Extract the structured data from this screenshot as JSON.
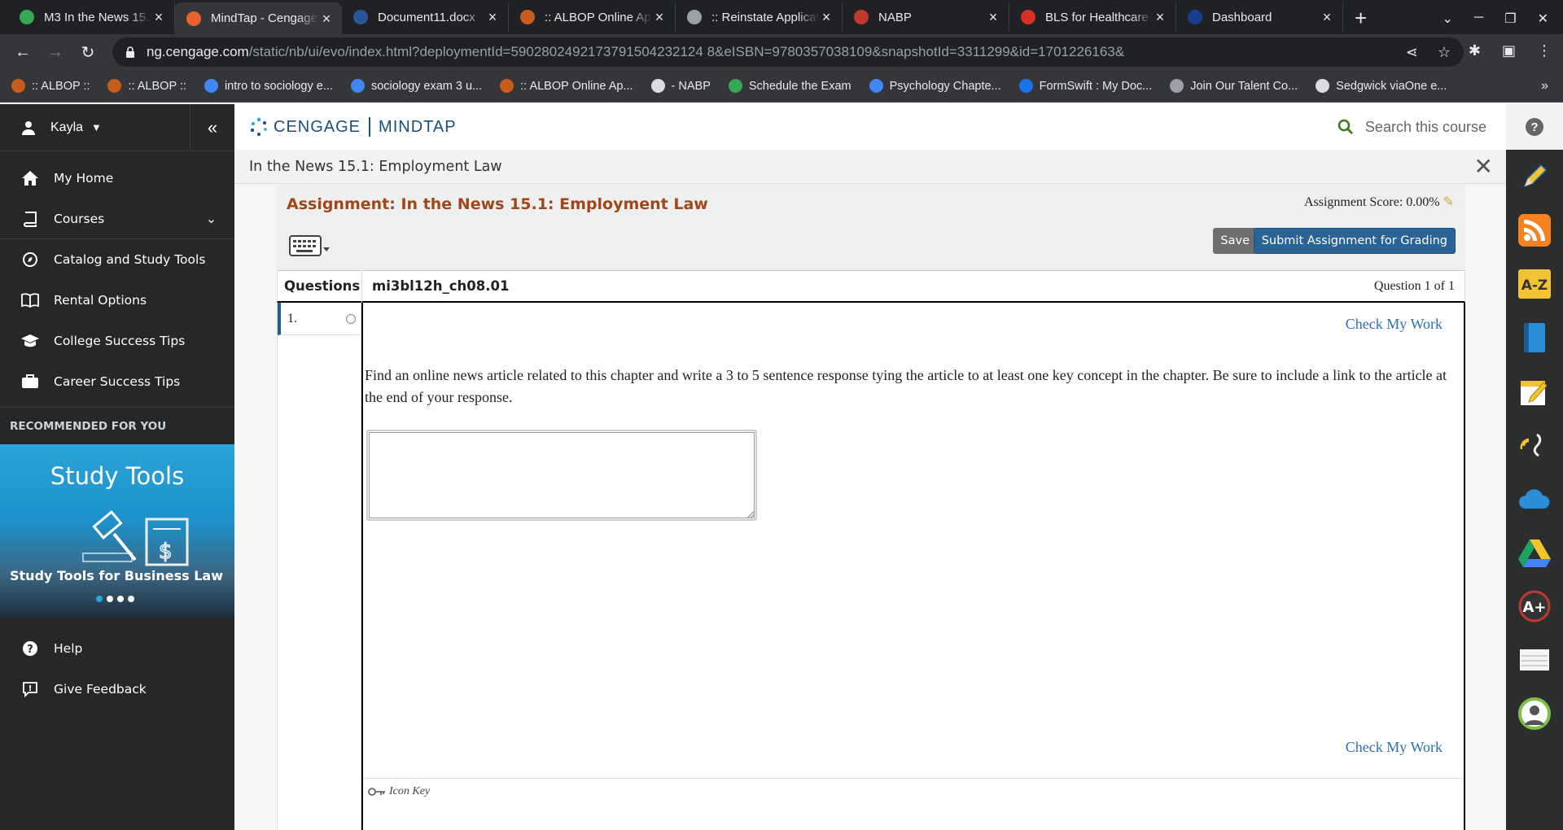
{
  "browser": {
    "tabs": [
      {
        "title": "M3 In the News 15.1",
        "icon_color": "#34a853",
        "active": false
      },
      {
        "title": "MindTap - Cengage Learning",
        "icon_color": "#e8632b",
        "active": true
      },
      {
        "title": "Document11.docx",
        "icon_color": "#2b579a",
        "active": false
      },
      {
        "title": ":: ALBOP Online Applications",
        "icon_color": "#c65d1c",
        "active": false
      },
      {
        "title": ":: Reinstate Application",
        "icon_color": "#9aa0a6",
        "active": false
      },
      {
        "title": "NABP",
        "icon_color": "#c0392b",
        "active": false
      },
      {
        "title": "BLS for Healthcare Providers",
        "icon_color": "#d93025",
        "active": false
      },
      {
        "title": "Dashboard",
        "icon_color": "#1a3d8f",
        "active": false
      }
    ],
    "url_host": "ng.cengage.com",
    "url_path": "/static/nb/ui/evo/index.html?deploymentId=5902802492173791504232124 8&eISBN=9780357038109&snapshotId=3311299&id=1701226163&",
    "bookmarks": [
      {
        "label": ":: ALBOP ::",
        "color": "#c65d1c"
      },
      {
        "label": ":: ALBOP ::",
        "color": "#c65d1c"
      },
      {
        "label": "intro to sociology e...",
        "color": "#4285f4"
      },
      {
        "label": "sociology exam 3 u...",
        "color": "#4285f4"
      },
      {
        "label": ":: ALBOP Online Ap...",
        "color": "#c65d1c"
      },
      {
        "label": "- NABP",
        "color": "#dadce0"
      },
      {
        "label": "Schedule the Exam",
        "color": "#34a853"
      },
      {
        "label": "Psychology Chapte...",
        "color": "#4285f4"
      },
      {
        "label": "FormSwift : My Doc...",
        "color": "#1a73e8"
      },
      {
        "label": "Join Our Talent Co...",
        "color": "#9aa0a6"
      },
      {
        "label": "Sedgwick viaOne e...",
        "color": "#dadce0"
      }
    ],
    "bookmarks_more": "»"
  },
  "sidebar": {
    "user_name": "Kayla",
    "items": [
      {
        "label": "My Home"
      },
      {
        "label": "Courses"
      },
      {
        "label": "Catalog and Study Tools"
      },
      {
        "label": "Rental Options"
      },
      {
        "label": "College Success Tips"
      },
      {
        "label": "Career Success Tips"
      }
    ],
    "recommended_label": "RECOMMENDED FOR YOU",
    "promo": {
      "title": "Study Tools",
      "subtitle": "Study Tools for Business Law"
    },
    "bottom_items": [
      {
        "label": "Help"
      },
      {
        "label": "Give Feedback"
      }
    ]
  },
  "header": {
    "brand_left": "CENGAGE",
    "brand_right": "MINDTAP",
    "search_placeholder": "Search this course"
  },
  "activity": {
    "title": "In the News 15.1: Employment Law",
    "assignment_title": "Assignment: In the News 15.1: Employment Law",
    "score_label": "Assignment Score: 0.00%",
    "save_label": "Save",
    "submit_label": "Submit Assignment for Grading",
    "questions_label": "Questions",
    "question_id": "mi3bl12h_ch08.01",
    "question_counter": "Question 1 of 1",
    "question_number": "1.",
    "check_label": "Check My Work",
    "prompt": "Find an online news article related to this chapter and write a 3 to 5 sentence response tying the article to at least one key concept in the chapter. Be sure to include a link to the article at the end of your response.",
    "answer_value": "",
    "icon_key_label": "Icon Key"
  }
}
